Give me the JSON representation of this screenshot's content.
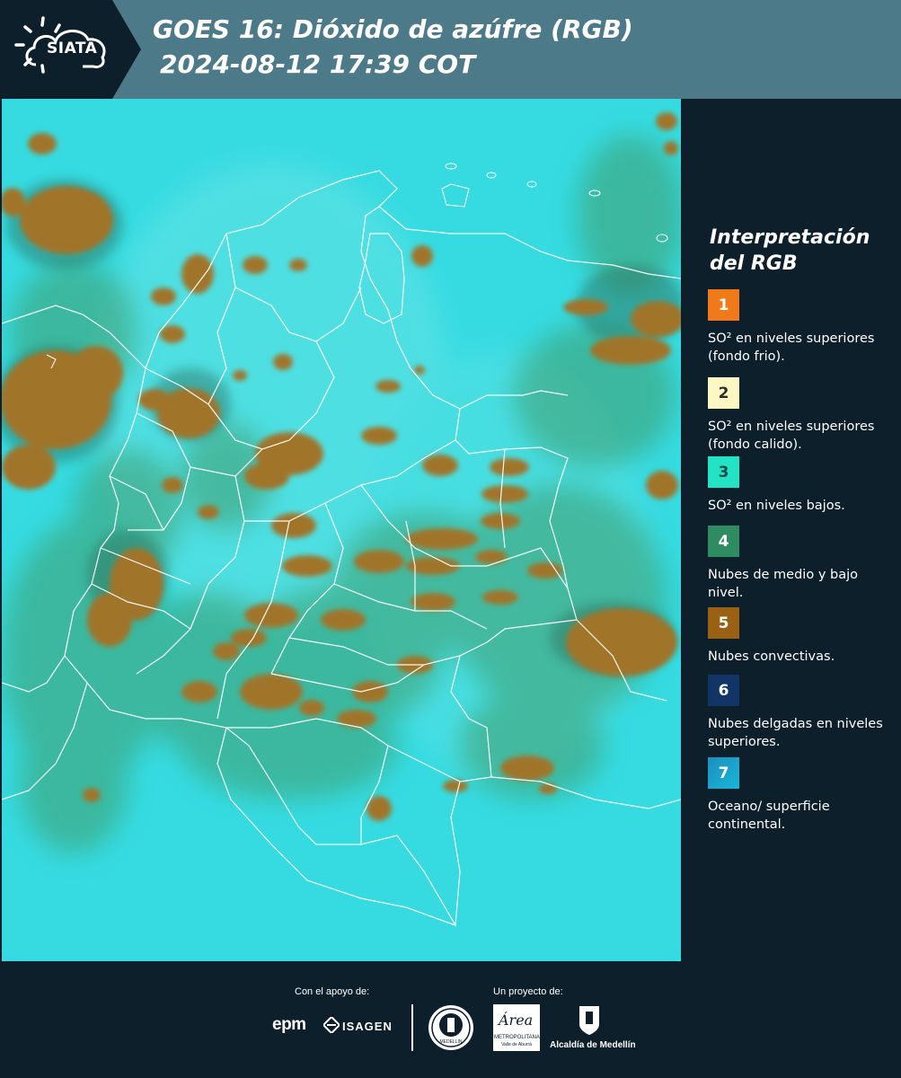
{
  "header": {
    "logo_text": "SIATA",
    "title_line1": "GOES 16: Dióxido de azúfre (RGB)",
    "title_line2": "2024-08-12 17:39 COT"
  },
  "legend": {
    "title_line1": "Interpretación",
    "title_line2": "del RGB",
    "items": [
      {
        "number": "1",
        "label": "SO² en niveles superiores (fondo frio).",
        "color": "#f07a1a"
      },
      {
        "number": "2",
        "label": "SO² en niveles superiores (fondo calido).",
        "color": "#fdf7c4"
      },
      {
        "number": "3",
        "label": "SO² en niveles bajos.",
        "color": "#22e3c3"
      },
      {
        "number": "4",
        "label": "Nubes de medio y bajo nivel.",
        "color": "#2e8b62"
      },
      {
        "number": "5",
        "label": "Nubes convectivas.",
        "color": "#9a6115"
      },
      {
        "number": "6",
        "label": "Nubes delgadas en niveles superiores.",
        "color": "#123567"
      },
      {
        "number": "7",
        "label": "Oceano/ superficie continental.",
        "color": "#1d8fbf"
      }
    ]
  },
  "footer": {
    "support_label": "Con el apoyo de:",
    "project_label": "Un proyecto de:",
    "sponsor1": "epm",
    "sponsor2": "ISAGEN",
    "partner_area_line1": "METROPOLITANA",
    "partner_area_line2": "Valle de Aburrá",
    "partner_area_script": "Área",
    "partner_alcaldia": "Alcaldía de Medellín",
    "seal_text": "MEDELLÍN"
  },
  "colors": {
    "header_bg": "#4d7a88",
    "page_bg": "#0d1f2b",
    "ocean_cyan": "#35dbe1",
    "cloud_brown": "#a0742c",
    "cloud_green": "#3f9c6a"
  }
}
